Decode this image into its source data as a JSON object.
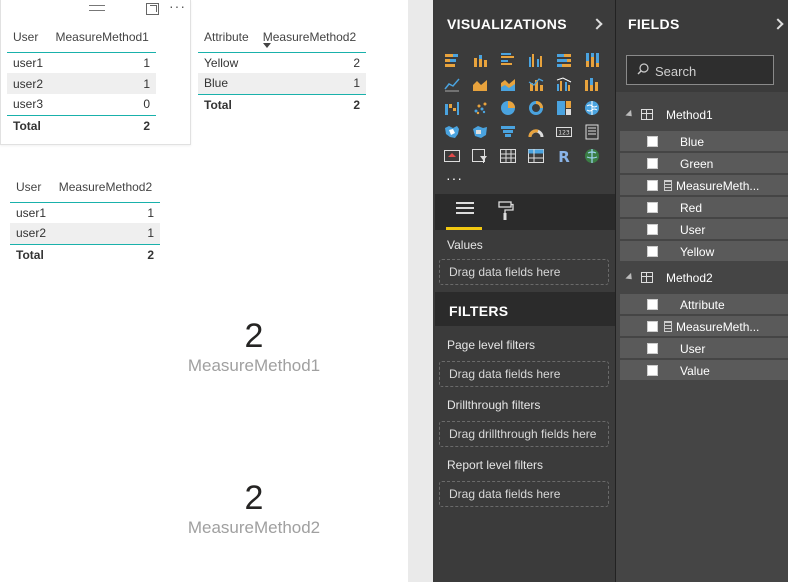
{
  "canvas": {
    "table1": {
      "headers": [
        "User",
        "MeasureMethod1"
      ],
      "rows": [
        [
          "user1",
          "1"
        ],
        [
          "user2",
          "1"
        ],
        [
          "user3",
          "0"
        ]
      ],
      "total": [
        "Total",
        "2"
      ]
    },
    "table2": {
      "headers": [
        "Attribute",
        "MeasureMethod2"
      ],
      "rows": [
        [
          "Yellow",
          "2"
        ],
        [
          "Blue",
          "1"
        ]
      ],
      "total": [
        "Total",
        "2"
      ]
    },
    "table3": {
      "headers": [
        "User",
        "MeasureMethod2"
      ],
      "rows": [
        [
          "user1",
          "1"
        ],
        [
          "user2",
          "1"
        ]
      ],
      "total": [
        "Total",
        "2"
      ]
    },
    "card1": {
      "value": "2",
      "label": "MeasureMethod1"
    },
    "card2": {
      "value": "2",
      "label": "MeasureMethod2"
    }
  },
  "visualizations": {
    "title": "VISUALIZATIONS",
    "more": "···",
    "values_label": "Values",
    "values_well": "Drag data fields here"
  },
  "filters": {
    "title": "FILTERS",
    "page_label": "Page level filters",
    "page_well": "Drag data fields here",
    "drill_label": "Drillthrough filters",
    "drill_well": "Drag drillthrough fields here",
    "report_label": "Report level filters",
    "report_well": "Drag data fields here"
  },
  "fields": {
    "title": "FIELDS",
    "search_placeholder": "Search",
    "tables": [
      {
        "name": "Method1",
        "fields": [
          "Blue",
          "Green",
          "MeasureMeth...",
          "Red",
          "User",
          "Yellow"
        ],
        "calc_index": 2
      },
      {
        "name": "Method2",
        "fields": [
          "Attribute",
          "MeasureMeth...",
          "User",
          "Value"
        ],
        "calc_index": 1
      }
    ]
  },
  "colors": {
    "accent_teal": "#19b1ab",
    "pane_dark": "#3b3b3b",
    "tab_active": "#f2c811"
  }
}
